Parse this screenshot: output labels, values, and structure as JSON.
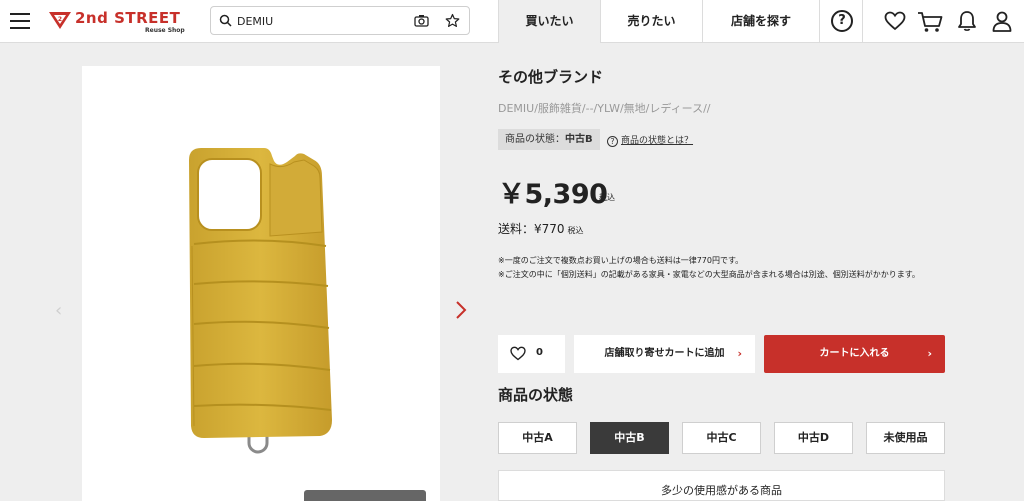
{
  "header": {
    "logo_text": "2nd STREET",
    "logo_sub": "Reuse Shop",
    "search_value": "DEMIU",
    "nav": [
      {
        "label": "買いたい"
      },
      {
        "label": "売りたい"
      },
      {
        "label": "店舗を探す"
      }
    ],
    "help_label": "?"
  },
  "product": {
    "brand": "その他ブランド",
    "breadcrumb": "DEMIU/服飾雑貨/--/YLW/無地/レディース//",
    "condition_label": "商品の状態：",
    "condition_value": "中古B",
    "condition_help": "商品の状態とは？",
    "price": "￥5,390",
    "price_tax": "税込",
    "shipping": "送料：¥770",
    "shipping_tax": "税込",
    "note1": "※一度のご注文で複数点お買い上げの場合も送料は一律770円です。",
    "note2": "※ご注文の中に「個別送料」の記載がある家具・家電などの大型商品が含まれる場合は別途、個別送料がかかります。",
    "like_count": "0",
    "store_button": "店舗取り寄せカートに追加",
    "cart_button": "カートに入れる"
  },
  "condition": {
    "title": "商品の状態",
    "grades": [
      "中古A",
      "中古B",
      "中古C",
      "中古D",
      "未使用品"
    ],
    "selected": "中古B",
    "description": "多少の使用感がある商品"
  },
  "colors": {
    "accent": "#c7302a",
    "phone_case": "#d8b23a",
    "selected_grade": "#3a3a3a"
  }
}
